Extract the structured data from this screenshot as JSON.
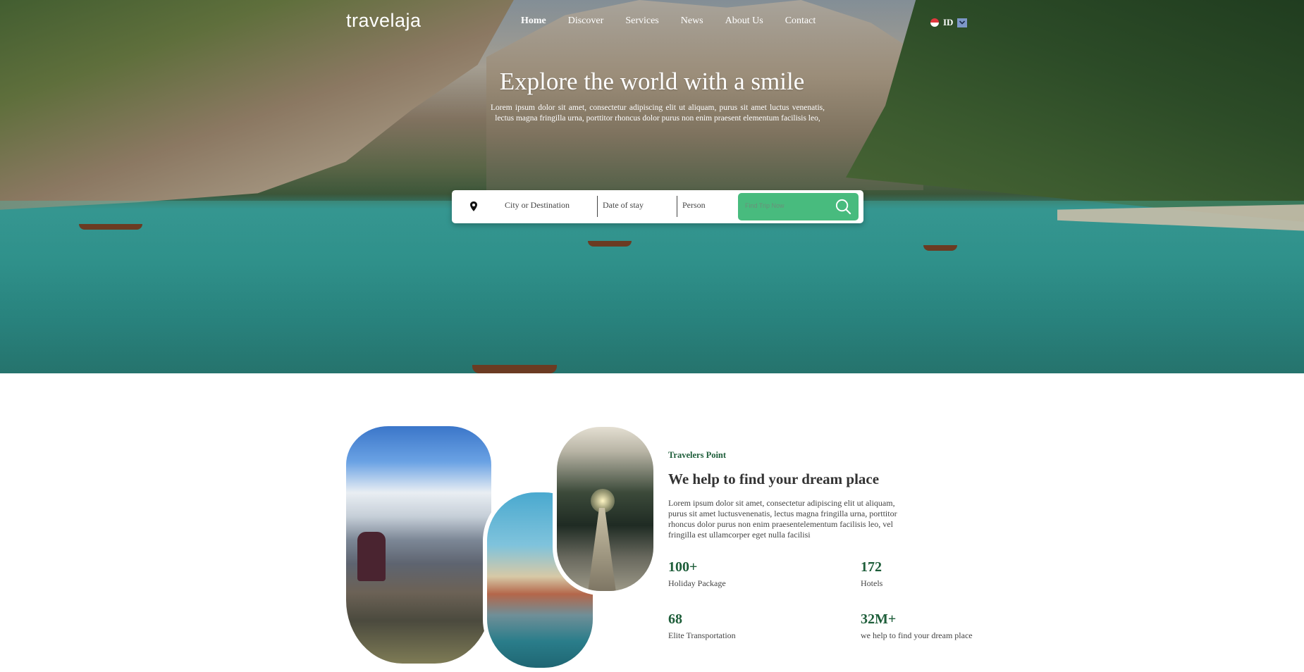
{
  "brand": {
    "logo": "travelaja"
  },
  "nav": {
    "items": [
      {
        "label": "Home",
        "active": true
      },
      {
        "label": "Discover"
      },
      {
        "label": "Services"
      },
      {
        "label": "News"
      },
      {
        "label": "About Us"
      },
      {
        "label": "Contact"
      }
    ],
    "language": "ID"
  },
  "hero": {
    "title": "Explore the world with a smile",
    "subtitle": "Lorem ipsum dolor sit amet, consectetur adipiscing elit ut aliquam, purus sit amet luctus venenatis, lectus magna fringilla urna, porttitor rhoncus dolor purus non enim praesent elementum facilisis leo,"
  },
  "search": {
    "destination_placeholder": "City or Destination",
    "date_placeholder": "Date of stay",
    "person_placeholder": "Person",
    "button_label": "Find Trip Now",
    "button_color": "#48bb7e"
  },
  "about": {
    "eyebrow": "Travelers Point",
    "title": "We help to find your dream place",
    "body": "Lorem ipsum dolor sit amet, consectetur adipiscing elit ut aliquam, purus sit amet luctusvenenatis, lectus magna fringilla urna, porttitor rhoncus dolor purus non enim praesentelementum facilisis leo, vel fringilla est ullamcorper eget nulla facilisi",
    "stats": [
      {
        "value": "100+",
        "label": "Holiday Package"
      },
      {
        "value": "172",
        "label": "Hotels"
      },
      {
        "value": "68",
        "label": "Elite Transportation"
      },
      {
        "value": "32M+",
        "label": "we help to find your dream place"
      }
    ],
    "accent_color": "#1e5e3a"
  }
}
